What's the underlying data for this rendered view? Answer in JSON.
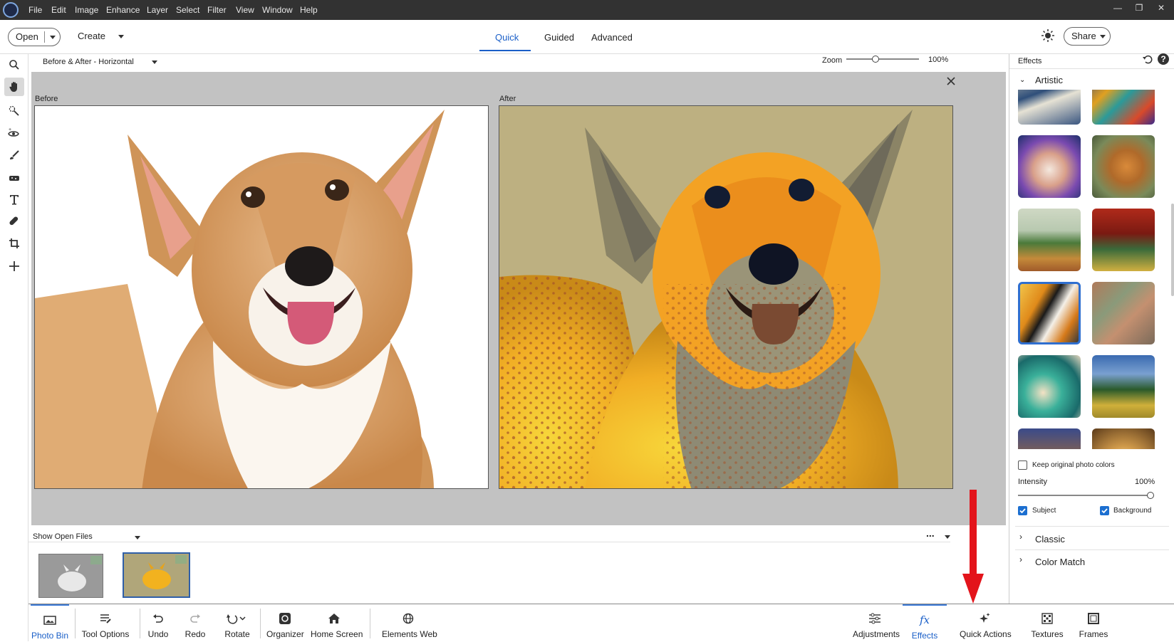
{
  "menubar": {
    "items": [
      "File",
      "Edit",
      "Image",
      "Enhance",
      "Layer",
      "Select",
      "Filter",
      "View",
      "Window",
      "Help"
    ],
    "window_controls": [
      "minimize",
      "restore",
      "close"
    ]
  },
  "topbar": {
    "open_label": "Open",
    "create_label": "Create",
    "modes": [
      "Quick",
      "Guided",
      "Advanced"
    ],
    "active_mode": "Quick",
    "share_label": "Share"
  },
  "tools": [
    "zoom-icon",
    "hand-icon",
    "quick-selection-icon",
    "eye-icon",
    "brush-icon",
    "sponge-icon",
    "text-icon",
    "healing-icon",
    "crop-icon",
    "move-icon"
  ],
  "view_options": {
    "view_mode": "Before & After - Horizontal",
    "zoom_label": "Zoom",
    "zoom_value": "100%",
    "zoom_level": 0.4
  },
  "canvas": {
    "before_label": "Before",
    "after_label": "After"
  },
  "photo_bin": {
    "show_label": "Show Open Files",
    "more": "..."
  },
  "bottombar": {
    "left": [
      {
        "label": "Photo Bin",
        "icon": "photo-bin-icon",
        "active": true
      },
      {
        "label": "Tool Options",
        "icon": "tool-options-icon",
        "active": false
      },
      {
        "label": "Undo",
        "icon": "undo-icon",
        "active": false
      },
      {
        "label": "Redo",
        "icon": "redo-icon",
        "active": false
      },
      {
        "label": "Rotate",
        "icon": "rotate-icon",
        "active": false
      },
      {
        "label": "Organizer",
        "icon": "organizer-icon",
        "active": false
      },
      {
        "label": "Home Screen",
        "icon": "home-icon",
        "active": false
      },
      {
        "label": "Elements Web",
        "icon": "globe-icon",
        "active": false
      }
    ],
    "right": [
      {
        "label": "Adjustments",
        "icon": "adjustments-icon",
        "active": false
      },
      {
        "label": "Effects",
        "icon": "fx-icon",
        "active": true
      },
      {
        "label": "Quick Actions",
        "icon": "sparkle-icon",
        "active": false
      },
      {
        "label": "Textures",
        "icon": "textures-icon",
        "active": false
      },
      {
        "label": "Frames",
        "icon": "frames-icon",
        "active": false
      }
    ]
  },
  "effects_panel": {
    "title": "Effects",
    "category_open": "Artistic",
    "keep_colors_label": "Keep original photo colors",
    "keep_colors_checked": false,
    "intensity_label": "Intensity",
    "intensity_value": "100%",
    "intensity_level": 1.0,
    "subject_label": "Subject",
    "subject_checked": true,
    "background_label": "Background",
    "background_checked": true,
    "categories_closed": [
      "Classic",
      "Color Match"
    ]
  },
  "colors": {
    "accent": "#1a5fc8",
    "menubar_bg": "#323232",
    "canvas_bg": "#c2c2c2",
    "annotation_arrow": "#e3141b"
  }
}
